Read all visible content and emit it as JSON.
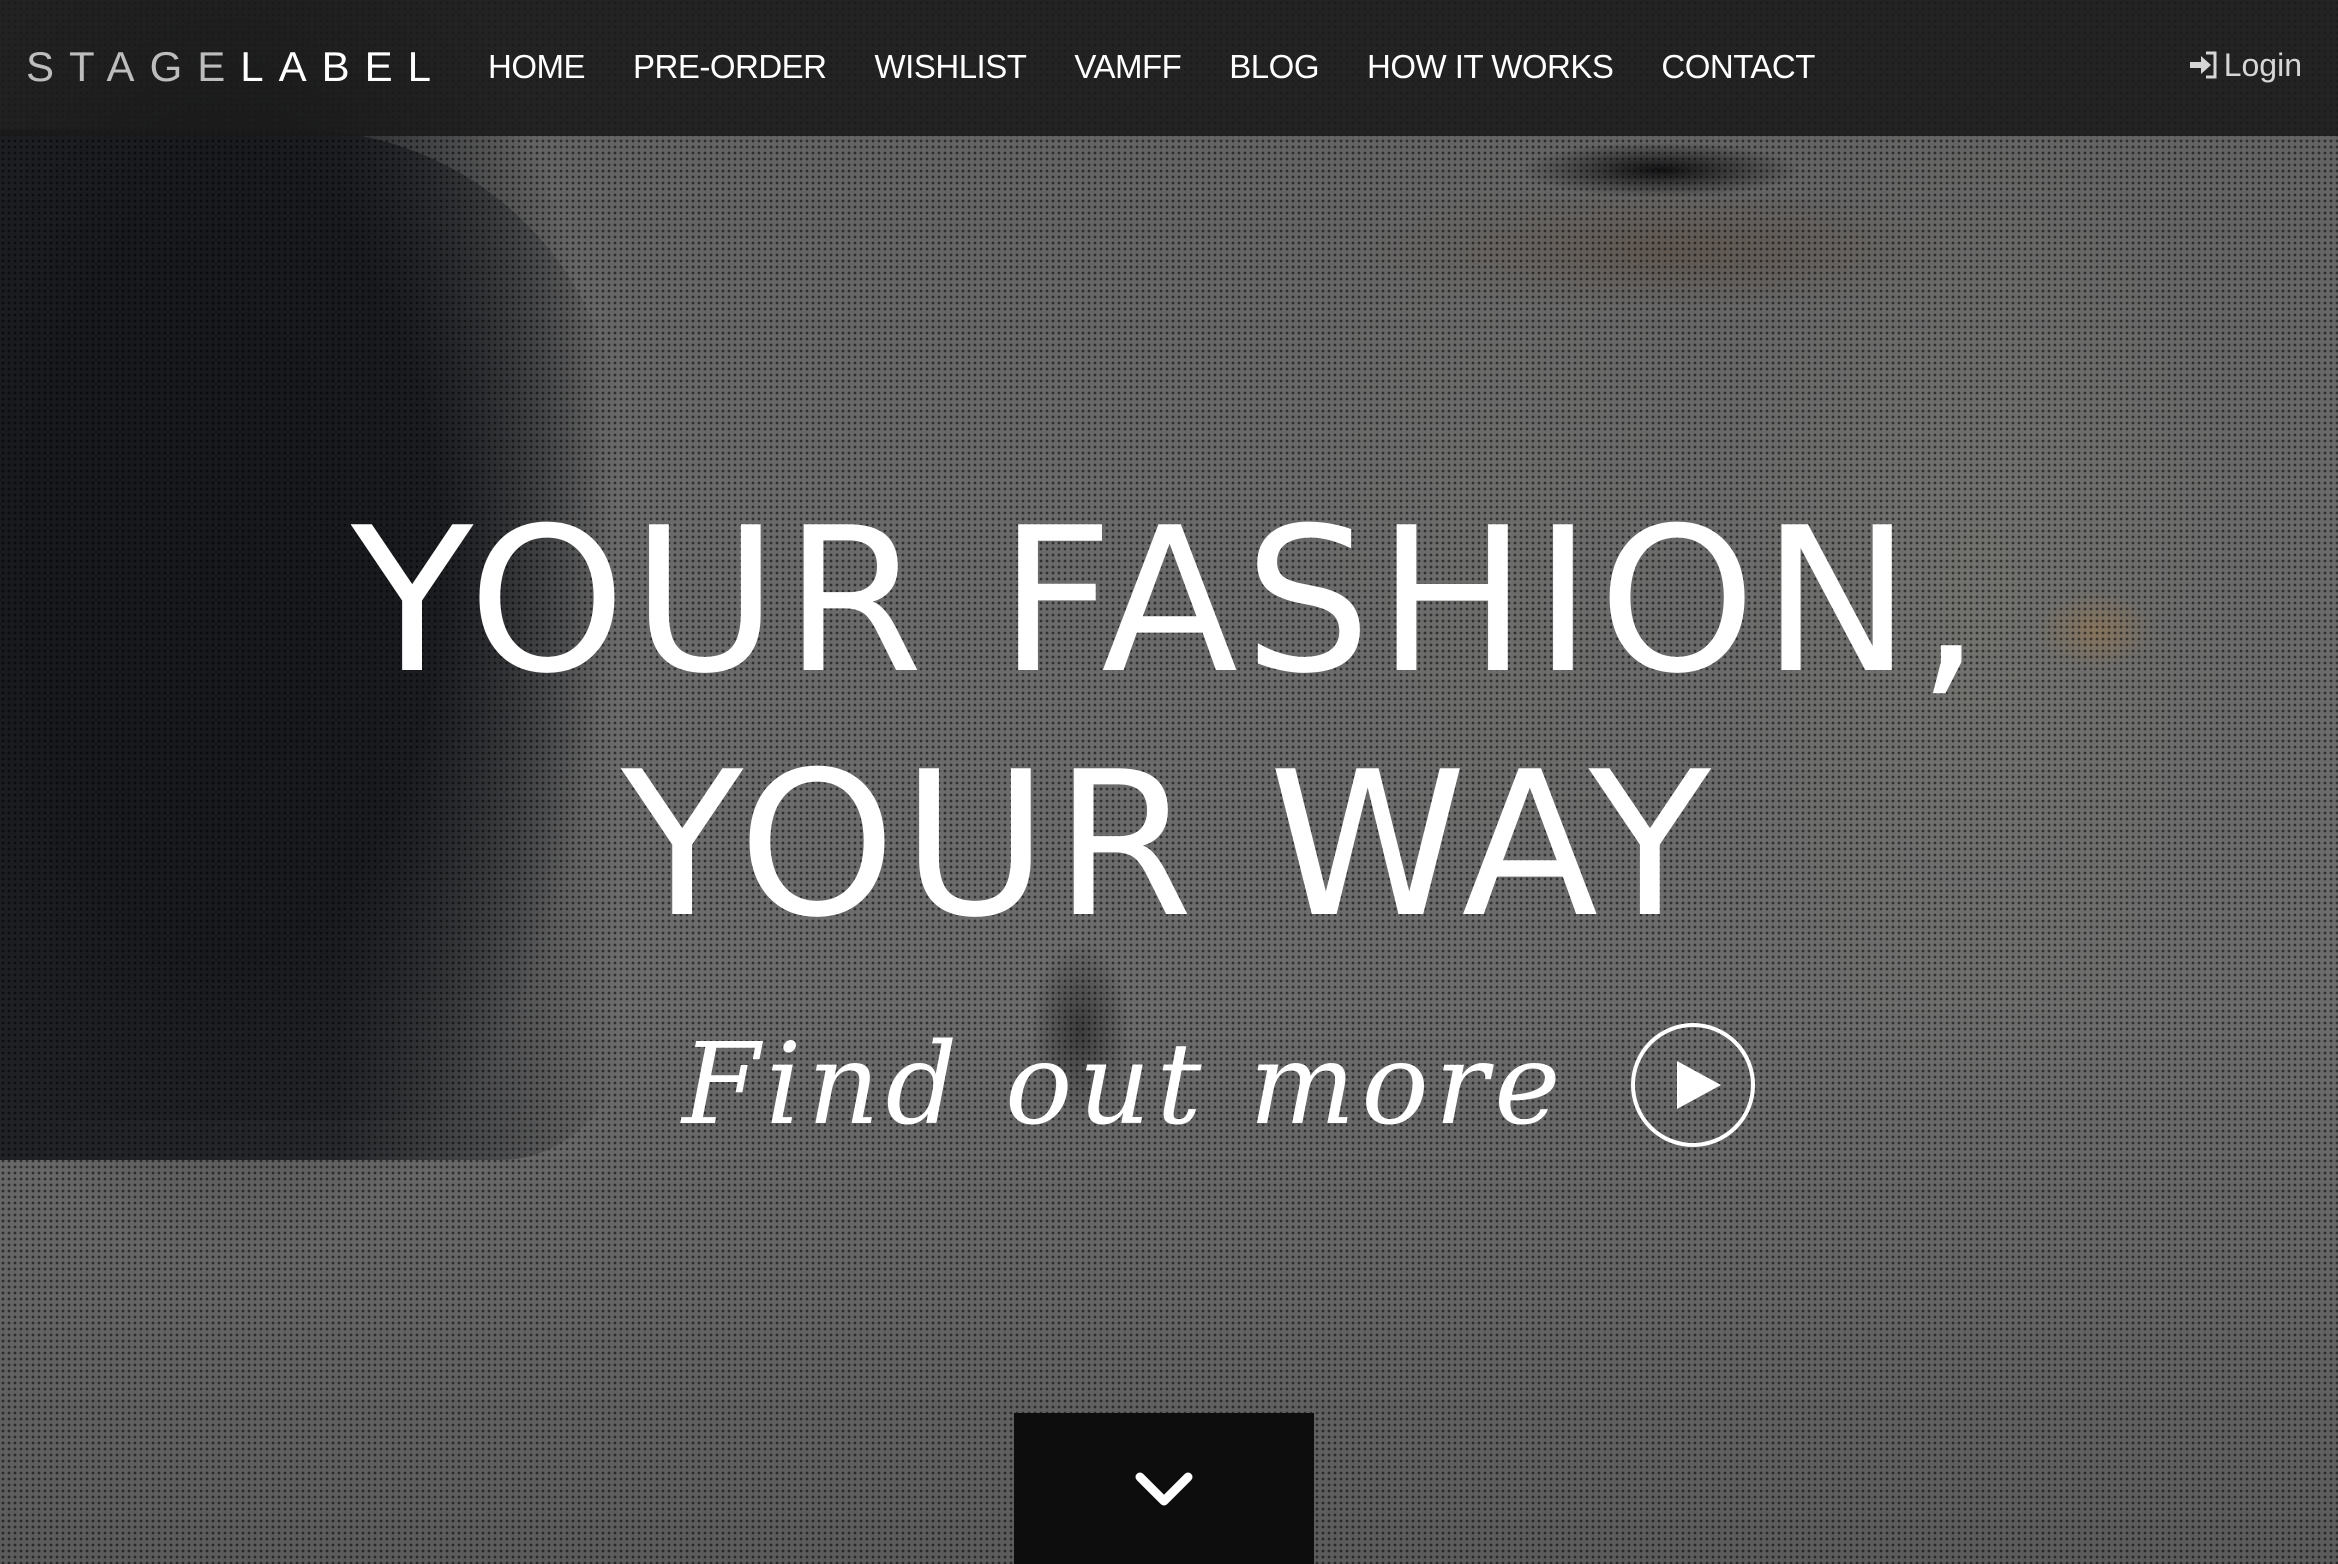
{
  "brand": {
    "logo_part1": "STAGE",
    "logo_part2": "LABEL"
  },
  "nav": {
    "items": [
      {
        "label": "HOME"
      },
      {
        "label": "PRE-ORDER"
      },
      {
        "label": "WISHLIST"
      },
      {
        "label": "VAMFF"
      },
      {
        "label": "BLOG"
      },
      {
        "label": "HOW IT WORKS"
      },
      {
        "label": "CONTACT"
      }
    ],
    "login_label": "Login",
    "login_icon": "sign-in-icon"
  },
  "hero": {
    "headline_line1": "YOUR FASHION,",
    "headline_line2": "YOUR WAY",
    "cta_label": "Find out more",
    "cta_icon": "play-icon",
    "scroll_icon": "chevron-down-icon"
  },
  "colors": {
    "navbar_bg": "#1a1a1a",
    "text": "#ffffff",
    "logo_stage": "#bdbdbd",
    "scroll_button_bg": "#0d0d0d"
  }
}
